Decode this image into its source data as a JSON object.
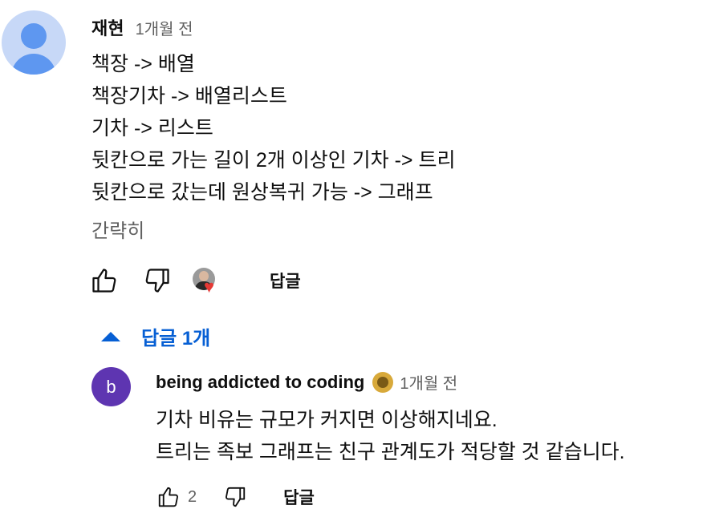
{
  "comment": {
    "author": "재현",
    "time": "1개월 전",
    "lines": [
      "책장 -> 배열",
      "책장기차 -> 배열리스트",
      "기차 -> 리스트",
      "뒷칸으로 가는 길이 2개 이상인 기차 -> 트리",
      "뒷칸으로 갔는데 원상복귀 가능 -> 그래프"
    ],
    "collapse_label": "간략히",
    "reply_label": "답글",
    "hearted_by_creator": true
  },
  "replies": {
    "toggle_label": "답글 1개",
    "items": [
      {
        "avatar_letter": "b",
        "avatar_color": "#5e35b1",
        "author": "being addicted to coding",
        "time": "1개월 전",
        "lines": [
          "기차 비유는 규모가 커지면 이상해지네요.",
          "트리는 족보 그래프는 친구 관계도가 적당할 것 같습니다."
        ],
        "like_count": "2",
        "reply_label": "답글"
      }
    ]
  },
  "colors": {
    "accent_blue": "#065fd4",
    "secondary_text": "#606060",
    "heart": "#e53935",
    "default_avatar_bg": "#c7d8f7",
    "default_avatar_fg": "#5e97f0"
  }
}
